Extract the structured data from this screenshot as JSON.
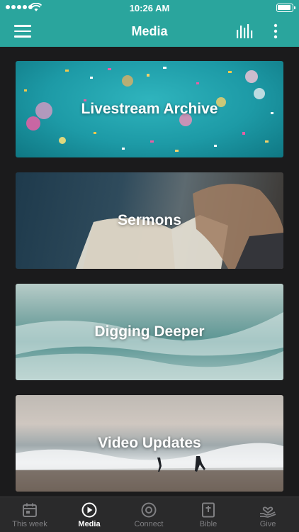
{
  "status_bar": {
    "time": "10:26 AM"
  },
  "header": {
    "title": "Media",
    "menu_icon": "hamburger-icon",
    "chart_icon": "bars-icon",
    "more_icon": "vertical-dots-icon"
  },
  "media_items": [
    {
      "label": "Livestream Archive"
    },
    {
      "label": "Sermons"
    },
    {
      "label": "Digging Deeper"
    },
    {
      "label": "Video Updates"
    }
  ],
  "tabs": [
    {
      "label": "This week",
      "icon": "calendar-icon",
      "active": false
    },
    {
      "label": "Media",
      "icon": "play-circle-icon",
      "active": true
    },
    {
      "label": "Connect",
      "icon": "connect-circle-icon",
      "active": false
    },
    {
      "label": "Bible",
      "icon": "bible-icon",
      "active": false
    },
    {
      "label": "Give",
      "icon": "give-heart-icon",
      "active": false
    }
  ],
  "colors": {
    "header": "#2aa59d",
    "background": "#1b1b1c",
    "tabbar": "#2a2a2b",
    "tab_inactive": "#7f7f82",
    "tab_active": "#ffffff"
  }
}
